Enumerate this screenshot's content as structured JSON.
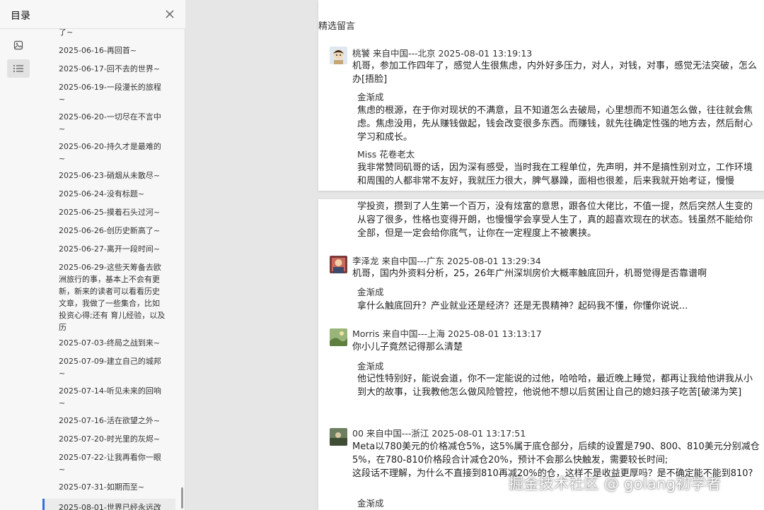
{
  "sidebar": {
    "title": "目录",
    "toc": [
      "了~",
      "2025-06-16-再回首~",
      "2025-06-17-回不去的世界~",
      "2025-06-19-一段漫长的旅程~",
      "2025-06-20-一切尽在不言中~",
      "2025-06-20-持久才是最难的~",
      "2025-06-23-硝烟从未散尽~",
      "2025-06-24-没有标题~",
      "2025-06-25-摸着石头过河~",
      "2025-06-26-创历史新高了~",
      "2025-06-27-离开一段时间~",
      "2025-06-29-这些天筹备去欧洲旅行的事，基本上不会有更新，新来的读者可以看看历史文章，我做了一些集合，比如 投资心得;还有 育儿经验，以及 历",
      "2025-07-03-终局之战到来~",
      "2025-07-09-建立自己的城邦~",
      "2025-07-14-听见未来的回响~",
      "2025-07-16-活在欲望之外~",
      "2025-07-20-时光里的灰烬~",
      "2025-07-22-让我再看你一眼~",
      "2025-07-31-如期而至~",
      "2025-08-01-世界已经永远改"
    ],
    "active_index": 19
  },
  "document": {
    "section_title": "精选留言",
    "page1": {
      "comment": {
        "header": "桃饕 来自中国---北京 2025-08-01 13:19:13",
        "text": "机哥，参加工作四年了，感觉人生很焦虑，内外好多压力，对人，对钱，对事，感觉无法突破，怎么办[捂脸]"
      },
      "replies": [
        {
          "name": "金渐成",
          "text": "焦虑的根源，在于你对现状的不满意，且不知道怎么去破局，心里想而不知道怎么做，往往就会焦虑。焦虑没用，先从赚钱做起，钱会改变很多东西。而赚钱，就先往确定性强的地方去，然后耐心学习和成长。"
        },
        {
          "name": "Miss 花卷老太",
          "text": "我非常赞同矶哥的话，因为深有感受，当时我在工程单位，先声明，并不是搞性别对立，工作环境和周围的人都非常不友好，我就压力很大，脾气暴躁，面相也很差，后来我就开始考证，慢慢"
        }
      ]
    },
    "page2": {
      "continued_text": "学投资，攒到了人生第一个百万，没有炫富的意思，跟各位大佬比，不值一提，然后突然人生变的从容了很多，性格也变得开朗，也慢慢学会享受人生了，真的超喜欢现在的状态。钱虽然不能给你全部，但是一定会给你底气，让你在一定程度上不被裹挟。",
      "comments": [
        {
          "header": "李泽龙 来自中国---广东 2025-08-01 13:29:34",
          "text": "机哥，国内外资料分析，25，26年广州深圳房价大概率触底回升，机哥觉得是否靠谱啊",
          "reply_name": "金渐成",
          "reply_text": "拿什么触底回升？产业就业还是经济？还是无畏精神？起码我不懂，你懂你说说..."
        },
        {
          "header": "Morris 来自中国---上海 2025-08-01 13:13:17",
          "text": "你小儿子竟然记得那么清楚",
          "reply_name": "金渐成",
          "reply_text": "他记性特别好，能说会道，你不一定能说的过他，哈哈哈，最近晚上睡觉，都再让我给他讲我从小到大的故事，让我教他怎么做风险管控，他说他不想以后贫困让自己的媳妇孩子吃苦[破涕为笑]"
        },
        {
          "header": "00 来自中国---浙江 2025-08-01 13:17:51",
          "text": "Meta以780美元的价格减仓5%，这5%属于底仓部分，后续的设置是790、800、810美元分别减仓5%，在780-810价格段合计减仓20%，预计不会那么快触发，需要较长时间;\n这段话不理解，为什么不直接到810再减20%的仓，这样不是收益更厚吗？是不确定能不能到810?",
          "reply_name": "金渐成"
        }
      ]
    }
  },
  "watermark": "掘金技术社区 @ golang初学者"
}
